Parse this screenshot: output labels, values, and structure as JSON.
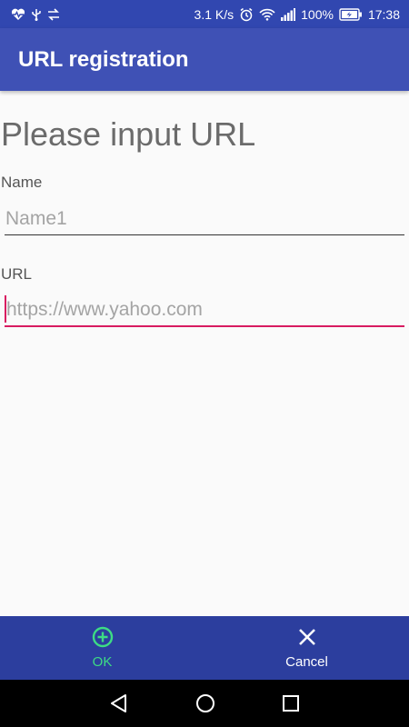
{
  "status_bar": {
    "network_speed": "3.1 K/s",
    "battery": "100%",
    "time": "17:38"
  },
  "app_bar": {
    "title": "URL registration"
  },
  "form": {
    "heading": "Please input URL",
    "name_label": "Name",
    "name_placeholder": "Name1",
    "url_label": "URL",
    "url_placeholder": "https://www.yahoo.com"
  },
  "actions": {
    "ok_label": "OK",
    "cancel_label": "Cancel"
  },
  "colors": {
    "primary": "#3f51b5",
    "primary_dark": "#3147b0",
    "accent": "#d81b60",
    "ok_green": "#3ddc84"
  },
  "icons": [
    "heart-pulse-icon",
    "usb-icon",
    "transfer-icon",
    "alarm-icon",
    "wifi-icon",
    "signal-icon",
    "battery-icon",
    "add-circle-icon",
    "close-icon",
    "back-icon",
    "home-icon",
    "recents-icon"
  ]
}
